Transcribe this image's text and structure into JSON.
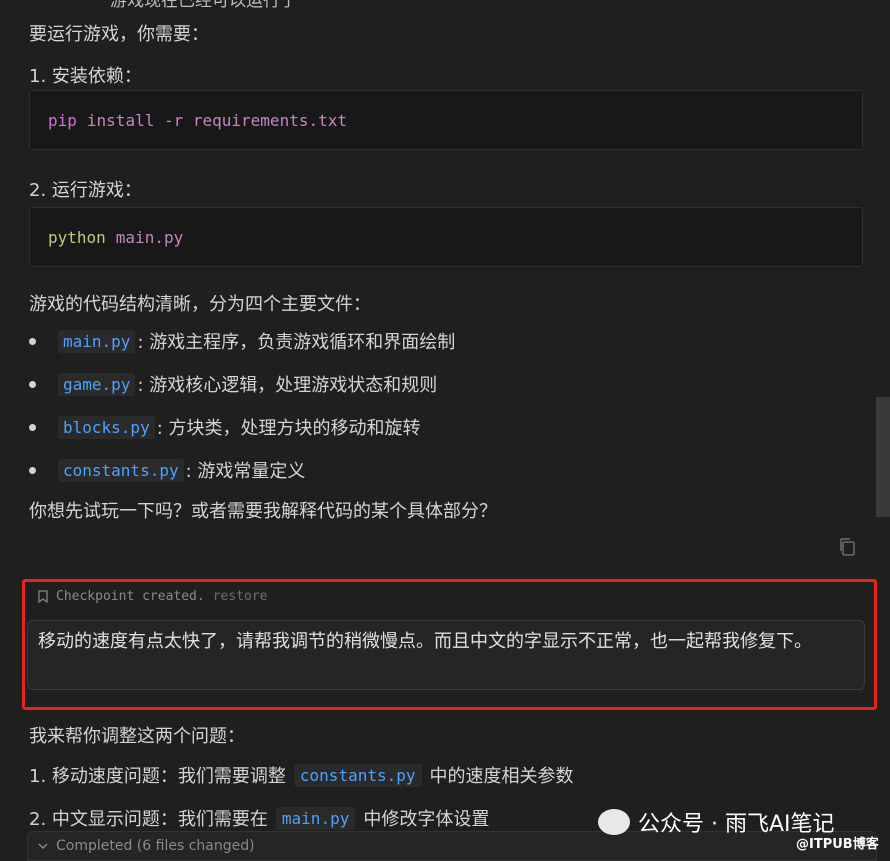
{
  "top_cut_text": "游戏现在已经可以运行了",
  "intro": "要运行游戏，你需要：",
  "step1": "1. 安装依赖：",
  "code1": {
    "cmd": "pip",
    "rest": "install -r requirements.txt"
  },
  "step2": "2. 运行游戏：",
  "code2": {
    "cmd": "python",
    "rest": "main.py"
  },
  "structure_intro": "游戏的代码结构清晰，分为四个主要文件：",
  "files": [
    {
      "name": "main.py",
      "desc": ": 游戏主程序，负责游戏循环和界面绘制"
    },
    {
      "name": "game.py",
      "desc": ": 游戏核心逻辑，处理游戏状态和规则"
    },
    {
      "name": "blocks.py",
      "desc": ": 方块类，处理方块的移动和旋转"
    },
    {
      "name": "constants.py",
      "desc": ": 游戏常量定义"
    }
  ],
  "question": "你想先试玩一下吗？或者需要我解释代码的某个具体部分？",
  "checkpoint": {
    "label": "Checkpoint created.",
    "restore": "restore"
  },
  "user_message": "移动的速度有点太快了，请帮我调节的稍微慢点。而且中文的字显示不正常，也一起帮我修复下。",
  "reply_intro": "我来帮你调整这两个问题：",
  "reply_item1": {
    "prefix": "1. 移动速度问题：我们需要调整",
    "file": "constants.py",
    "suffix": "中的速度相关参数"
  },
  "reply_item2": {
    "prefix": "2. 中文显示问题：我们需要在",
    "file": "main.py",
    "suffix": "中修改字体设置"
  },
  "completed_label": "Completed (6 files changed)",
  "watermark": {
    "main": "公众号 · 雨飞AI笔记",
    "small": "@ITPUB博客"
  },
  "colors": {
    "highlight_box": "#e5241d",
    "file_chip": "#4ea1ff",
    "background": "#1f1f1f"
  }
}
